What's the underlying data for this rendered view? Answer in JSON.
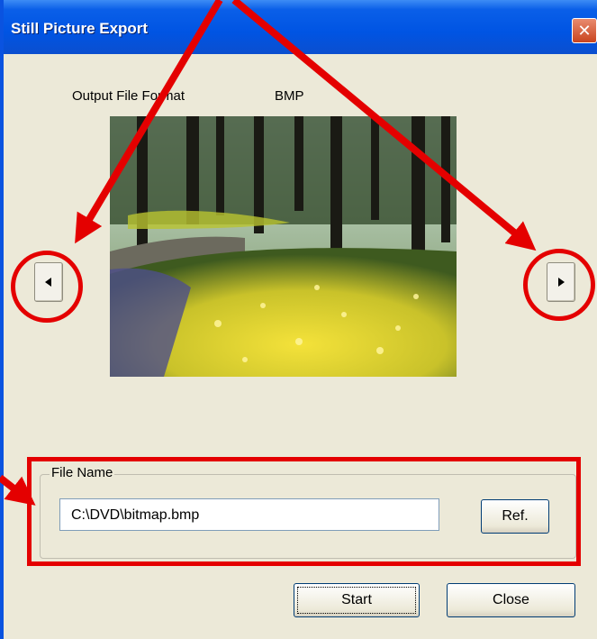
{
  "window": {
    "title": "Still Picture Export",
    "close_glyph": "✕"
  },
  "format": {
    "label": "Output File Format",
    "value": "BMP"
  },
  "preview": {
    "icon": "still-frame-image",
    "prev_glyph": "◀",
    "next_glyph": "▶"
  },
  "file_name": {
    "group_label": "File Name",
    "value": "C:\\DVD\\bitmap.bmp",
    "browse_label": "Ref."
  },
  "actions": {
    "start_label": "Start",
    "close_label": "Close"
  },
  "colors": {
    "title_bar": "#0054e3",
    "dialog_bg": "#ece9d8",
    "annotation": "#e40000"
  }
}
